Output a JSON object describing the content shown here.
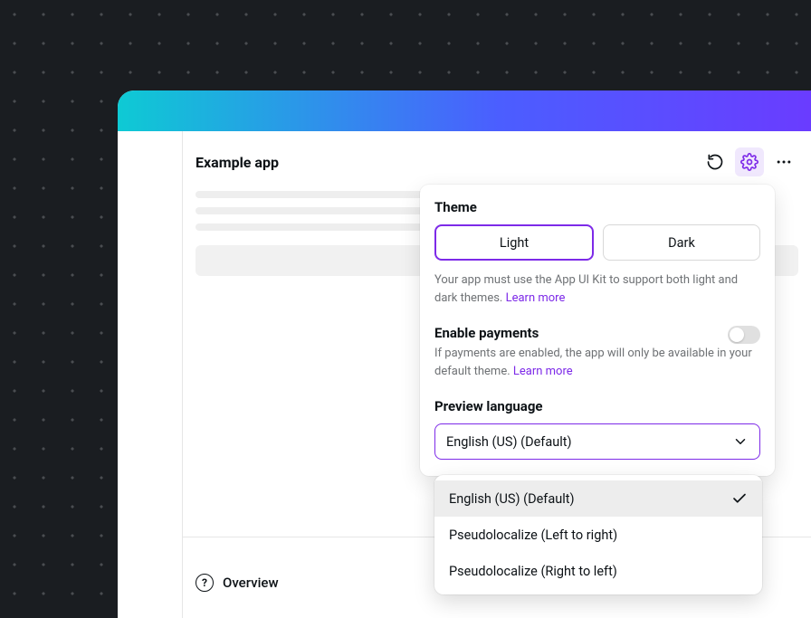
{
  "app": {
    "title": "Example app"
  },
  "popover": {
    "theme": {
      "label": "Theme",
      "light": "Light",
      "dark": "Dark",
      "help": "Your app must use the App UI Kit to support both light and dark themes. ",
      "learn_more": "Learn more"
    },
    "payments": {
      "label": "Enable payments",
      "help": "If payments are enabled, the app will only be available in your default theme. ",
      "learn_more": "Learn more",
      "enabled": false
    },
    "language": {
      "label": "Preview language",
      "selected": "English (US) (Default)",
      "options": [
        "English (US) (Default)",
        "Pseudolocalize (Left to right)",
        "Pseudolocalize (Right to left)"
      ]
    }
  },
  "bottom": {
    "overview": "Overview"
  }
}
